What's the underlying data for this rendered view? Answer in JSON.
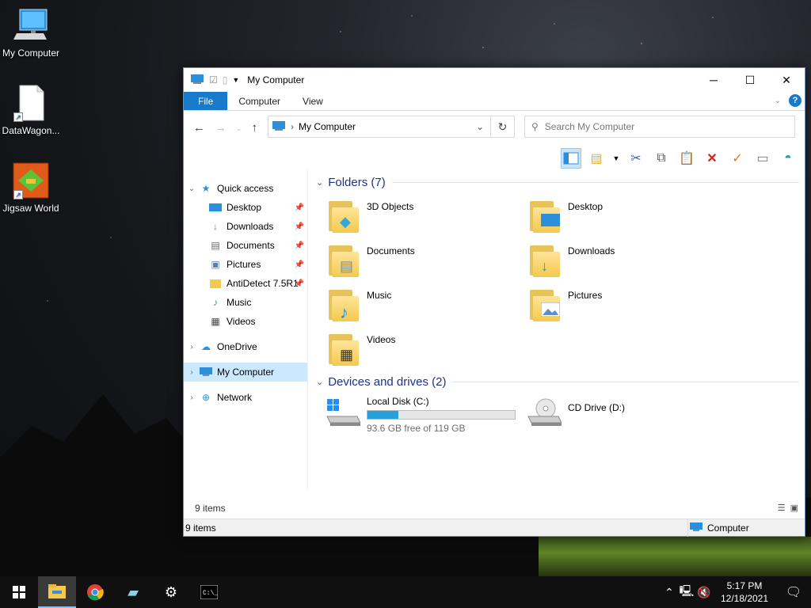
{
  "desktop": {
    "icons": [
      {
        "label": "My Computer",
        "icon": "computer-icon"
      },
      {
        "label": "DataWagon...",
        "icon": "document-shortcut-icon"
      },
      {
        "label": "Jigsaw World",
        "icon": "jigsaw-game-icon"
      }
    ]
  },
  "window": {
    "title": "My Computer",
    "ribbon": {
      "file": "File",
      "computer": "Computer",
      "view": "View"
    },
    "address": {
      "path": "My Computer"
    },
    "search": {
      "placeholder": "Search My Computer"
    },
    "nav": {
      "quick_access": "Quick access",
      "items": [
        "Desktop",
        "Downloads",
        "Documents",
        "Pictures",
        "AntiDetect 7.5R1",
        "Music",
        "Videos"
      ],
      "onedrive": "OneDrive",
      "my_computer": "My Computer",
      "network": "Network"
    },
    "folders": {
      "header": "Folders (7)",
      "items": [
        "3D Objects",
        "Desktop",
        "Documents",
        "Downloads",
        "Music",
        "Pictures",
        "Videos"
      ]
    },
    "drives": {
      "header": "Devices and drives (2)",
      "local": {
        "name": "Local Disk (C:)",
        "free": "93.6 GB free of 119 GB",
        "used_fraction": 0.21
      },
      "cd": {
        "name": "CD Drive (D:)"
      }
    },
    "status": {
      "items": "9 items",
      "items2": "9 items",
      "location": "Computer"
    }
  },
  "taskbar": {
    "time": "5:17 PM",
    "date": "12/18/2021",
    "apps": [
      "start-icon",
      "file-explorer-icon",
      "chrome-icon",
      "app-icon",
      "settings-icon",
      "terminal-icon"
    ]
  },
  "colors": {
    "accent": "#1979ca",
    "drive_bar": "#26a0da",
    "group_header": "#1e3287",
    "selection": "#cce8ff"
  }
}
